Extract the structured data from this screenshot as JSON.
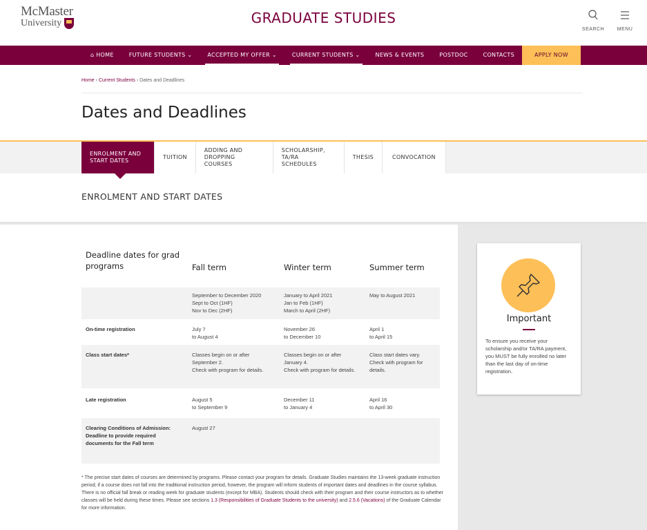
{
  "header": {
    "logo_line1": "McMaster",
    "logo_line2": "University",
    "site_title": "GRADUATE STUDIES",
    "search_label": "SEARCH",
    "menu_label": "MENU"
  },
  "nav": {
    "home": "HOME",
    "future": "FUTURE STUDENTS",
    "accepted": "ACCEPTED MY OFFER",
    "current": "CURRENT STUDENTS",
    "news": "NEWS & EVENTS",
    "postdoc": "POSTDOC",
    "contacts": "CONTACTS",
    "apply": "APPLY NOW",
    "chevron": "⌄"
  },
  "breadcrumb": {
    "home": "Home",
    "current": "Current Students",
    "page": "Dates and Deadlines",
    "sep": "›"
  },
  "page_title": "Dates and Deadlines",
  "tabs": [
    "ENROLMENT AND START DATES",
    "TUITION",
    "ADDING AND DROPPING COURSES",
    "SCHOLARSHIP, TA/RA SCHEDULES",
    "THESIS",
    "CONVOCATION"
  ],
  "section_title": "ENROLMENT AND START DATES",
  "table": {
    "headers": [
      "Deadline dates for grad programs",
      "Fall term",
      "Winter  term",
      "Summer term"
    ],
    "rows": [
      [
        "",
        "September to December 2020\nSept to Oct (1HF)\nNov to Dec (2HF)",
        "January to April 2021\nJan to Feb (1HF)\nMarch to April (2HF)",
        "May to August 2021"
      ],
      [
        "On-time registration",
        "July 7\nto August 4",
        "November 26\n to December 10",
        "April 1\nto April 15"
      ],
      [
        "Class start dates*",
        "Classes begin on or after September 2.\nCheck with program for details.",
        "Classes begin on or after January 4.\nCheck with program for details.",
        "Class start dates vary. Check with program for details."
      ],
      [
        "Late registration",
        "August 5\nto September 9",
        "December 11\n to January 4",
        "April 16\nto April 30"
      ],
      [
        "Clearing Conditions of Admission:\nDeadline to provide required documents for the Fall term",
        "August 27",
        "",
        ""
      ]
    ]
  },
  "note": {
    "text1": "* The precise start dates of courses are determined by programs. Please contact your program for details. Graduate Studies maintains the 13-week graduate instruction period; if a course does not fall into the traditional instruction period, however, the program will inform students of important dates and deadlines in the course syllabus. There is no official fall break or reading week for graduate students (except for MBA). Students should check with their program and their course instructors as to whether classes will be held during these times. Please see sections ",
    "link1": "1.3 (Responsibilities of Graduate Students to the university)",
    "text2": " and ",
    "link2": "2.5.6 (Vacations)",
    "text3": " of the Graduate Calendar for more information."
  },
  "important": {
    "title": "Important",
    "text": "To ensure you receive your scholarship and/or TA/RA payment, you MUST be fully enrolled no later than the last day of on-time registration."
  },
  "colors": {
    "maroon": "#7a003c",
    "gold": "#fdbf57"
  }
}
